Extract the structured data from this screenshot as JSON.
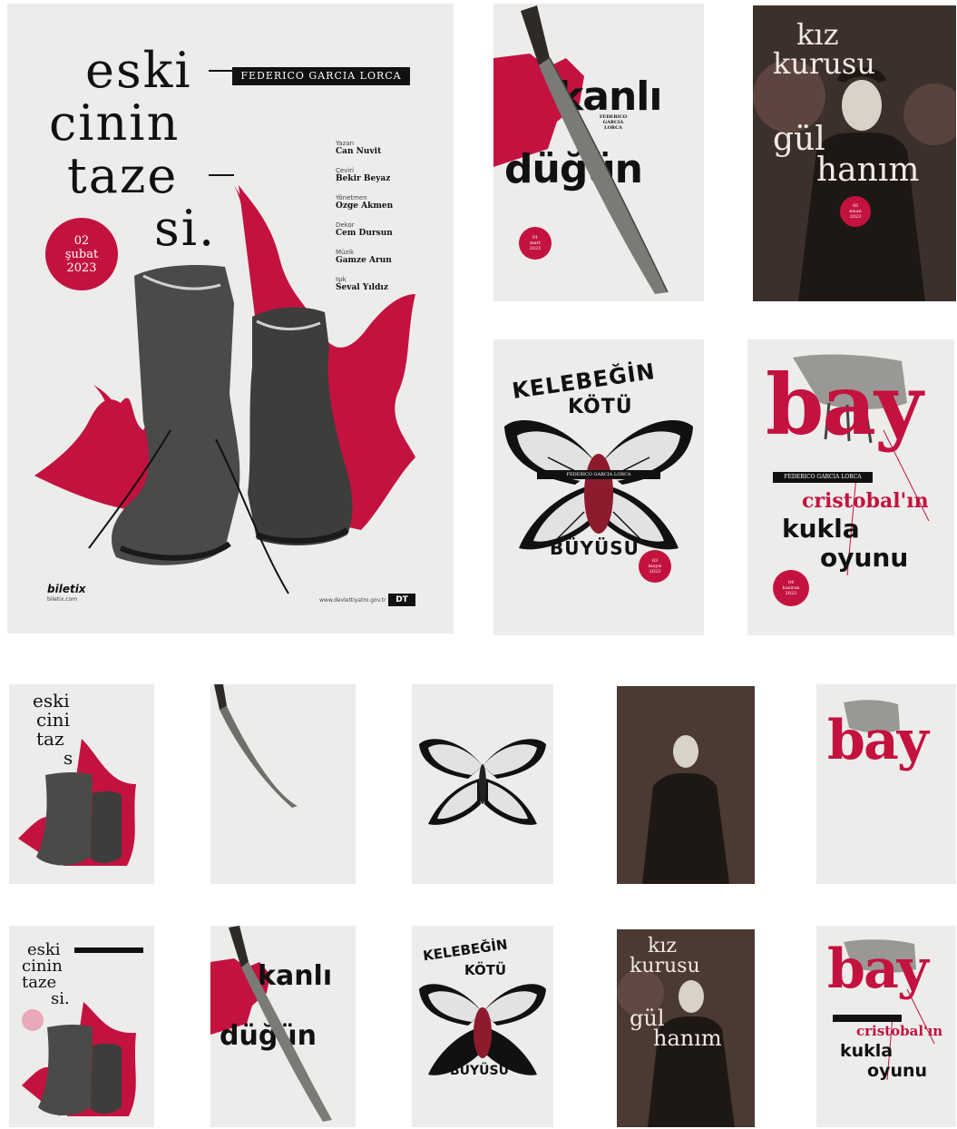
{
  "poster_eski": {
    "title_lines": [
      "eski",
      "cinin",
      "taze",
      "si."
    ],
    "author_bar": "FEDERICO GARCIA LORCA",
    "date_badge": [
      "02",
      "şubat",
      "2023"
    ],
    "credits": [
      {
        "role": "Yazan",
        "name": "Can Nuvit"
      },
      {
        "role": "Çeviri",
        "name": "Bekir Beyaz"
      },
      {
        "role": "Yönetmen",
        "name": "Ozge Akmen"
      },
      {
        "role": "Dekor",
        "name": "Cem Dursun"
      },
      {
        "role": "Müzik",
        "name": "Gamze Arun"
      },
      {
        "role": "Işık",
        "name": "Seval Yıldız"
      }
    ],
    "logo": "biletix",
    "logo_sub": "biletix.com",
    "footer_url": "www.devlettiyatro.gov.tr",
    "footer_badge": "DT"
  },
  "poster_kanli": {
    "title_top": "kanlı",
    "title_bottom": "düğün",
    "author_lines": [
      "FEDERICO",
      "GARCIA",
      "LORCA"
    ],
    "date_badge": [
      "01",
      "mart",
      "2023"
    ]
  },
  "poster_kiz": {
    "title_top": [
      "kız",
      "kurusu"
    ],
    "title_bottom": [
      "gül",
      "hanım"
    ],
    "date_badge": [
      "05",
      "nisan",
      "2023"
    ]
  },
  "poster_kelebek": {
    "title_top": "KELEBEĞİN",
    "title_mid": "KÖTÜ",
    "title_bottom": "BÜYÜSÜ",
    "author_bar": "FEDERICO GARCIA LORCA",
    "date_badge": [
      "03",
      "mayıs",
      "2023"
    ]
  },
  "poster_bay": {
    "title": "bay",
    "author_bar": "FEDERICO GARCIA LORCA",
    "subtitle_lines": [
      "cristobal'ın",
      "kukla",
      "oyunu"
    ],
    "date_badge": [
      "04",
      "haziran",
      "2023"
    ]
  },
  "row2": {
    "eski_lines": [
      "eski",
      "cini",
      "taz",
      "s"
    ],
    "bay_title": "bay"
  },
  "row3": {
    "eski_lines": [
      "eski",
      "cinin",
      "taze",
      "si."
    ],
    "kanli_top": "kanlı",
    "kanli_bottom": "düğün",
    "kelebek_top": "KELEBEĞİN",
    "kelebek_mid": "KÖTÜ",
    "kelebek_bottom": "BÜYÜSÜ",
    "kiz_top": [
      "kız",
      "kurusu"
    ],
    "kiz_bottom": [
      "gül",
      "hanım"
    ],
    "bay_title": "bay",
    "bay_sub": [
      "cristobal'ın",
      "kukla",
      "oyunu"
    ]
  },
  "colors": {
    "accent_red": "#c4123f",
    "paper": "#ececeb",
    "ink": "#111111",
    "sepia": "#3b302b"
  }
}
